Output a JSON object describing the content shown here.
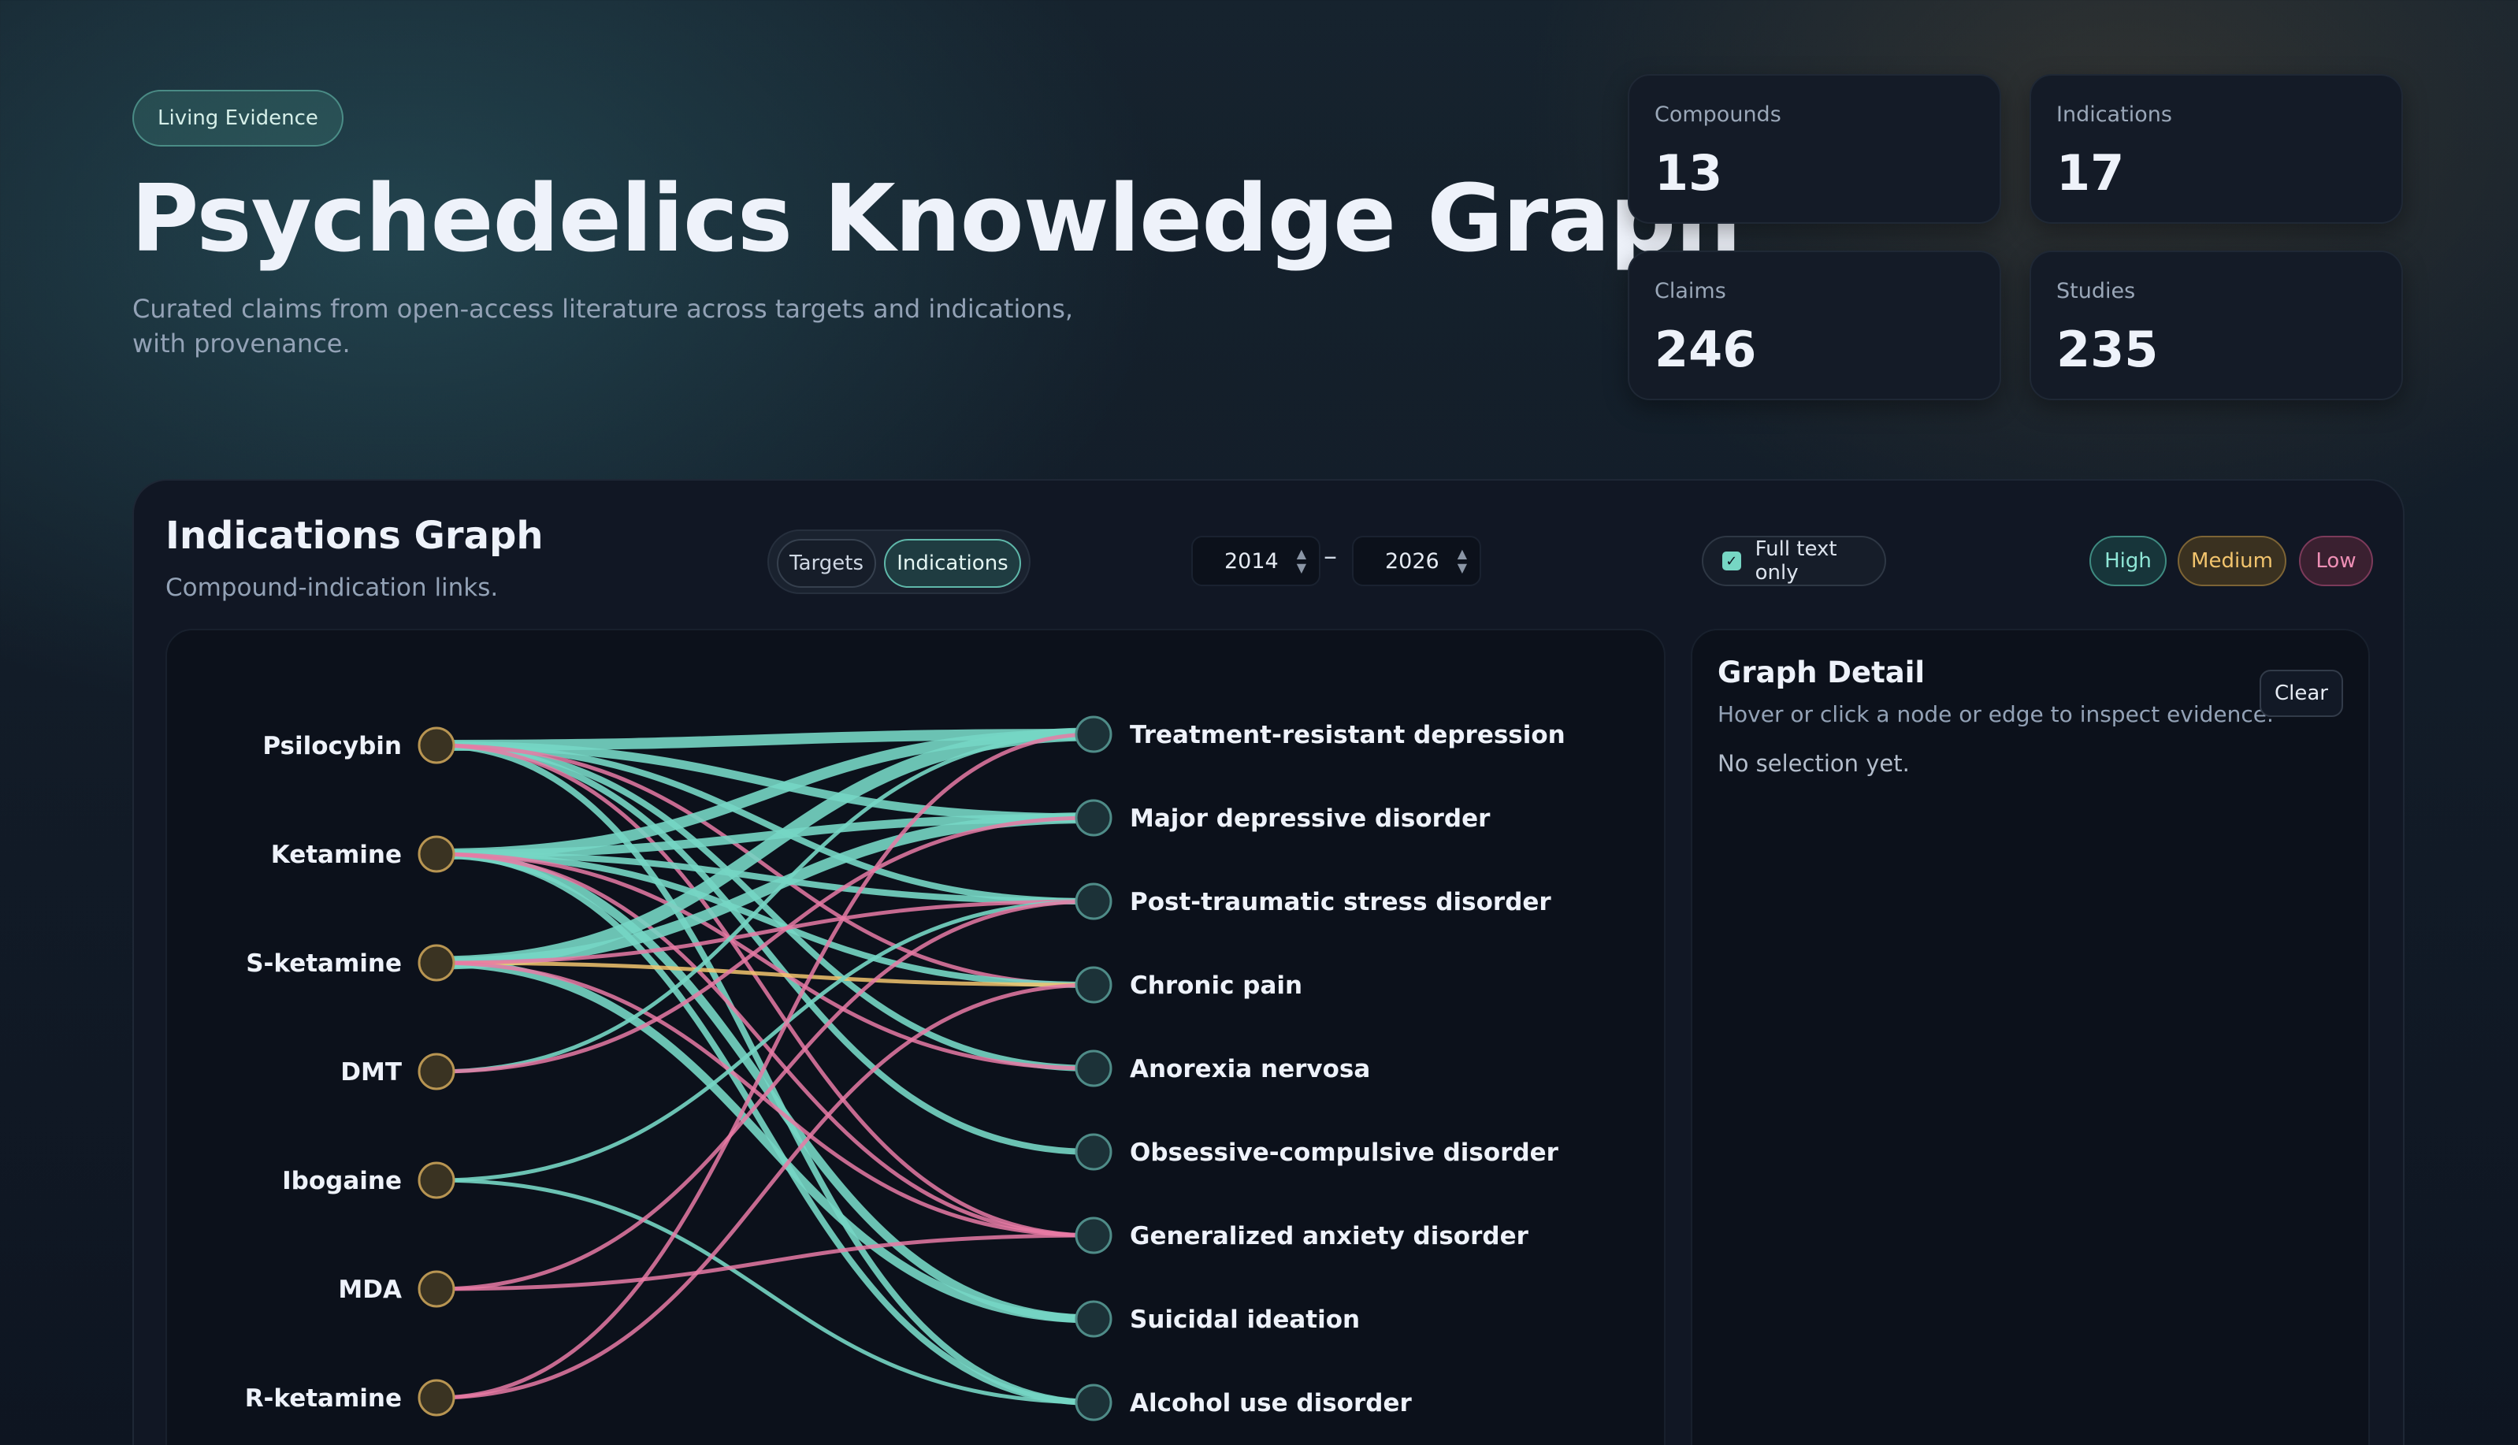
{
  "header": {
    "badge": "Living Evidence",
    "title": "Psychedelics Knowledge Graph",
    "subtitle": "Curated claims from open-access literature across targets and indications, with provenance."
  },
  "stats": [
    {
      "label": "Compounds",
      "value": "13"
    },
    {
      "label": "Indications",
      "value": "17"
    },
    {
      "label": "Claims",
      "value": "246"
    },
    {
      "label": "Studies",
      "value": "235"
    }
  ],
  "panel": {
    "title": "Indications Graph",
    "subtitle": "Compound-indication links.",
    "tabs": [
      {
        "label": "Targets",
        "active": false
      },
      {
        "label": "Indications",
        "active": true
      }
    ],
    "year_from": "2014",
    "year_to": "2026",
    "year_separator": "–",
    "full_text_label": "Full text only",
    "full_text_checked": true,
    "confidence": [
      {
        "label": "High",
        "color": "#76d6c4"
      },
      {
        "label": "Medium",
        "color": "#f2c46d"
      },
      {
        "label": "Low",
        "color": "#e87aa4"
      }
    ]
  },
  "graph": {
    "compounds": [
      "Psilocybin",
      "Ketamine",
      "S-ketamine",
      "DMT",
      "Ibogaine",
      "MDA",
      "R-ketamine"
    ],
    "indications": [
      "Treatment-resistant depression",
      "Major depressive disorder",
      "Post-traumatic stress disorder",
      "Chronic pain",
      "Anorexia nervosa",
      "Obsessive-compulsive disorder",
      "Generalized anxiety disorder",
      "Suicidal ideation",
      "Alcohol use disorder"
    ],
    "edges": [
      {
        "from": 0,
        "to": 0,
        "conf": "high",
        "weight": 4
      },
      {
        "from": 0,
        "to": 1,
        "conf": "high",
        "weight": 3
      },
      {
        "from": 0,
        "to": 2,
        "conf": "high",
        "weight": 2
      },
      {
        "from": 0,
        "to": 4,
        "conf": "high",
        "weight": 2
      },
      {
        "from": 0,
        "to": 5,
        "conf": "high",
        "weight": 2
      },
      {
        "from": 0,
        "to": 8,
        "conf": "high",
        "weight": 2
      },
      {
        "from": 0,
        "to": 6,
        "conf": "low",
        "weight": 1
      },
      {
        "from": 0,
        "to": 3,
        "conf": "low",
        "weight": 1
      },
      {
        "from": 1,
        "to": 0,
        "conf": "high",
        "weight": 4
      },
      {
        "from": 1,
        "to": 1,
        "conf": "high",
        "weight": 3
      },
      {
        "from": 1,
        "to": 2,
        "conf": "high",
        "weight": 2
      },
      {
        "from": 1,
        "to": 3,
        "conf": "high",
        "weight": 2
      },
      {
        "from": 1,
        "to": 7,
        "conf": "high",
        "weight": 3
      },
      {
        "from": 1,
        "to": 8,
        "conf": "high",
        "weight": 2
      },
      {
        "from": 1,
        "to": 6,
        "conf": "low",
        "weight": 1
      },
      {
        "from": 1,
        "to": 4,
        "conf": "low",
        "weight": 1
      },
      {
        "from": 2,
        "to": 0,
        "conf": "high",
        "weight": 5
      },
      {
        "from": 2,
        "to": 1,
        "conf": "high",
        "weight": 4
      },
      {
        "from": 2,
        "to": 7,
        "conf": "high",
        "weight": 3
      },
      {
        "from": 2,
        "to": 3,
        "conf": "medium",
        "weight": 1
      },
      {
        "from": 2,
        "to": 2,
        "conf": "low",
        "weight": 1
      },
      {
        "from": 2,
        "to": 6,
        "conf": "low",
        "weight": 1
      },
      {
        "from": 3,
        "to": 0,
        "conf": "high",
        "weight": 1
      },
      {
        "from": 3,
        "to": 1,
        "conf": "low",
        "weight": 1
      },
      {
        "from": 4,
        "to": 2,
        "conf": "high",
        "weight": 1
      },
      {
        "from": 4,
        "to": 8,
        "conf": "high",
        "weight": 1
      },
      {
        "from": 5,
        "to": 2,
        "conf": "low",
        "weight": 1
      },
      {
        "from": 5,
        "to": 6,
        "conf": "low",
        "weight": 1
      },
      {
        "from": 6,
        "to": 0,
        "conf": "low",
        "weight": 1
      },
      {
        "from": 6,
        "to": 3,
        "conf": "low",
        "weight": 1
      }
    ]
  }
}
